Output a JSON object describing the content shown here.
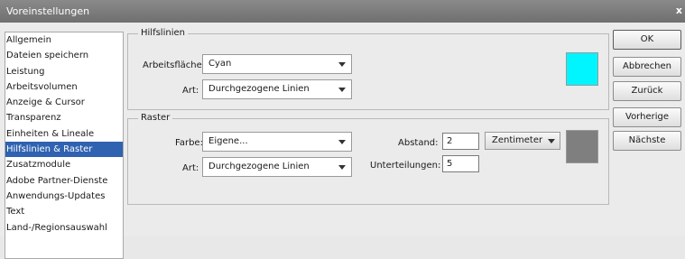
{
  "window": {
    "title": "Voreinstellungen",
    "close_glyph": "x"
  },
  "sidebar": {
    "items": [
      {
        "label": "Allgemein"
      },
      {
        "label": "Dateien speichern"
      },
      {
        "label": "Leistung"
      },
      {
        "label": "Arbeitsvolumen"
      },
      {
        "label": "Anzeige & Cursor"
      },
      {
        "label": "Transparenz"
      },
      {
        "label": "Einheiten & Lineale"
      },
      {
        "label": "Hilfslinien & Raster"
      },
      {
        "label": "Zusatzmodule"
      },
      {
        "label": "Adobe Partner-Dienste"
      },
      {
        "label": "Anwendungs-Updates"
      },
      {
        "label": "Text"
      },
      {
        "label": "Land-/Regionsauswahl"
      }
    ],
    "selected_index": 7,
    "selected_color": "#2f62b1"
  },
  "guides": {
    "title": "Hilfslinien",
    "workspace_label": "Arbeitsfläche:",
    "workspace_value": "Cyan",
    "style_label": "Art:",
    "style_value": "Durchgezogene Linien",
    "swatch_color": "#00f5ff"
  },
  "grid": {
    "title": "Raster",
    "color_label": "Farbe:",
    "color_value": "Eigene...",
    "style_label": "Art:",
    "style_value": "Durchgezogene Linien",
    "spacing_label": "Abstand:",
    "spacing_value": "2",
    "unit_value": "Zentimeter",
    "subdivisions_label": "Unterteilungen:",
    "subdivisions_value": "5",
    "swatch_color": "#7f7f7f"
  },
  "buttons": {
    "ok": "OK",
    "cancel": "Abbrechen",
    "reset": "Zurück",
    "prev": "Vorherige",
    "next": "Nächste"
  }
}
